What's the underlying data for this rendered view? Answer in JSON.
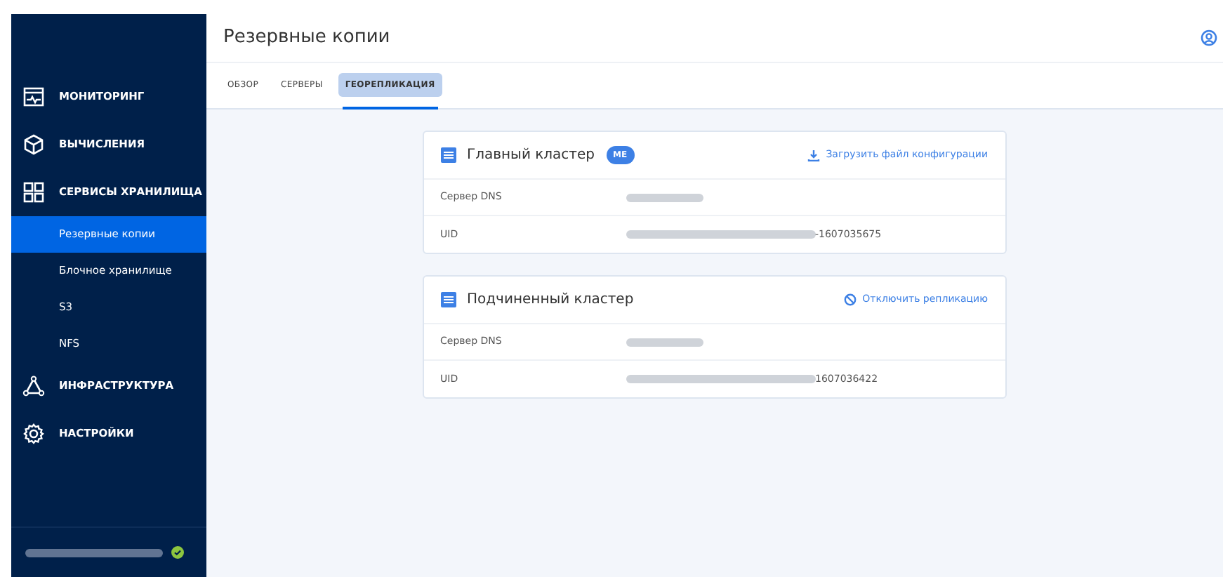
{
  "sidebar": {
    "items": [
      {
        "kind": "section",
        "label": "МОНИТОРИНГ",
        "selected": false
      },
      {
        "kind": "section",
        "label": "ВЫЧИСЛЕНИЯ",
        "selected": false
      },
      {
        "kind": "section",
        "label": "СЕРВИСЫ ХРАНИЛИЩА",
        "selected": false
      },
      {
        "kind": "sub",
        "label": "Резервные копии",
        "selected": true
      },
      {
        "kind": "sub",
        "label": "Блочное хранилище",
        "selected": false
      },
      {
        "kind": "sub",
        "label": "S3",
        "selected": false
      },
      {
        "kind": "sub",
        "label": "NFS",
        "selected": false
      },
      {
        "kind": "section",
        "label": "ИНФРАСТРУКТУРА",
        "selected": false
      },
      {
        "kind": "section",
        "label": "НАСТРОЙКИ",
        "selected": false
      }
    ]
  },
  "header": {
    "title": "Резервные копии"
  },
  "tabs": [
    {
      "label": "ОБЗОР",
      "selected": false
    },
    {
      "label": "СЕРВЕРЫ",
      "selected": false
    },
    {
      "label": "ГЕОРЕПЛИКАЦИЯ",
      "selected": true
    }
  ],
  "clusters": [
    {
      "title": "Главный кластер",
      "badge": "ME",
      "action": {
        "label": "Загрузить файл конфигурации"
      },
      "rows": [
        {
          "label": "Сервер DNS"
        },
        {
          "label": "UID",
          "value": "-1607035675"
        }
      ]
    },
    {
      "title": "Подчиненный кластер",
      "action": {
        "label": "Отключить репликацию"
      },
      "rows": [
        {
          "label": "Сервер DNS"
        },
        {
          "label": "UID",
          "value": "1607036422"
        }
      ]
    }
  ]
}
